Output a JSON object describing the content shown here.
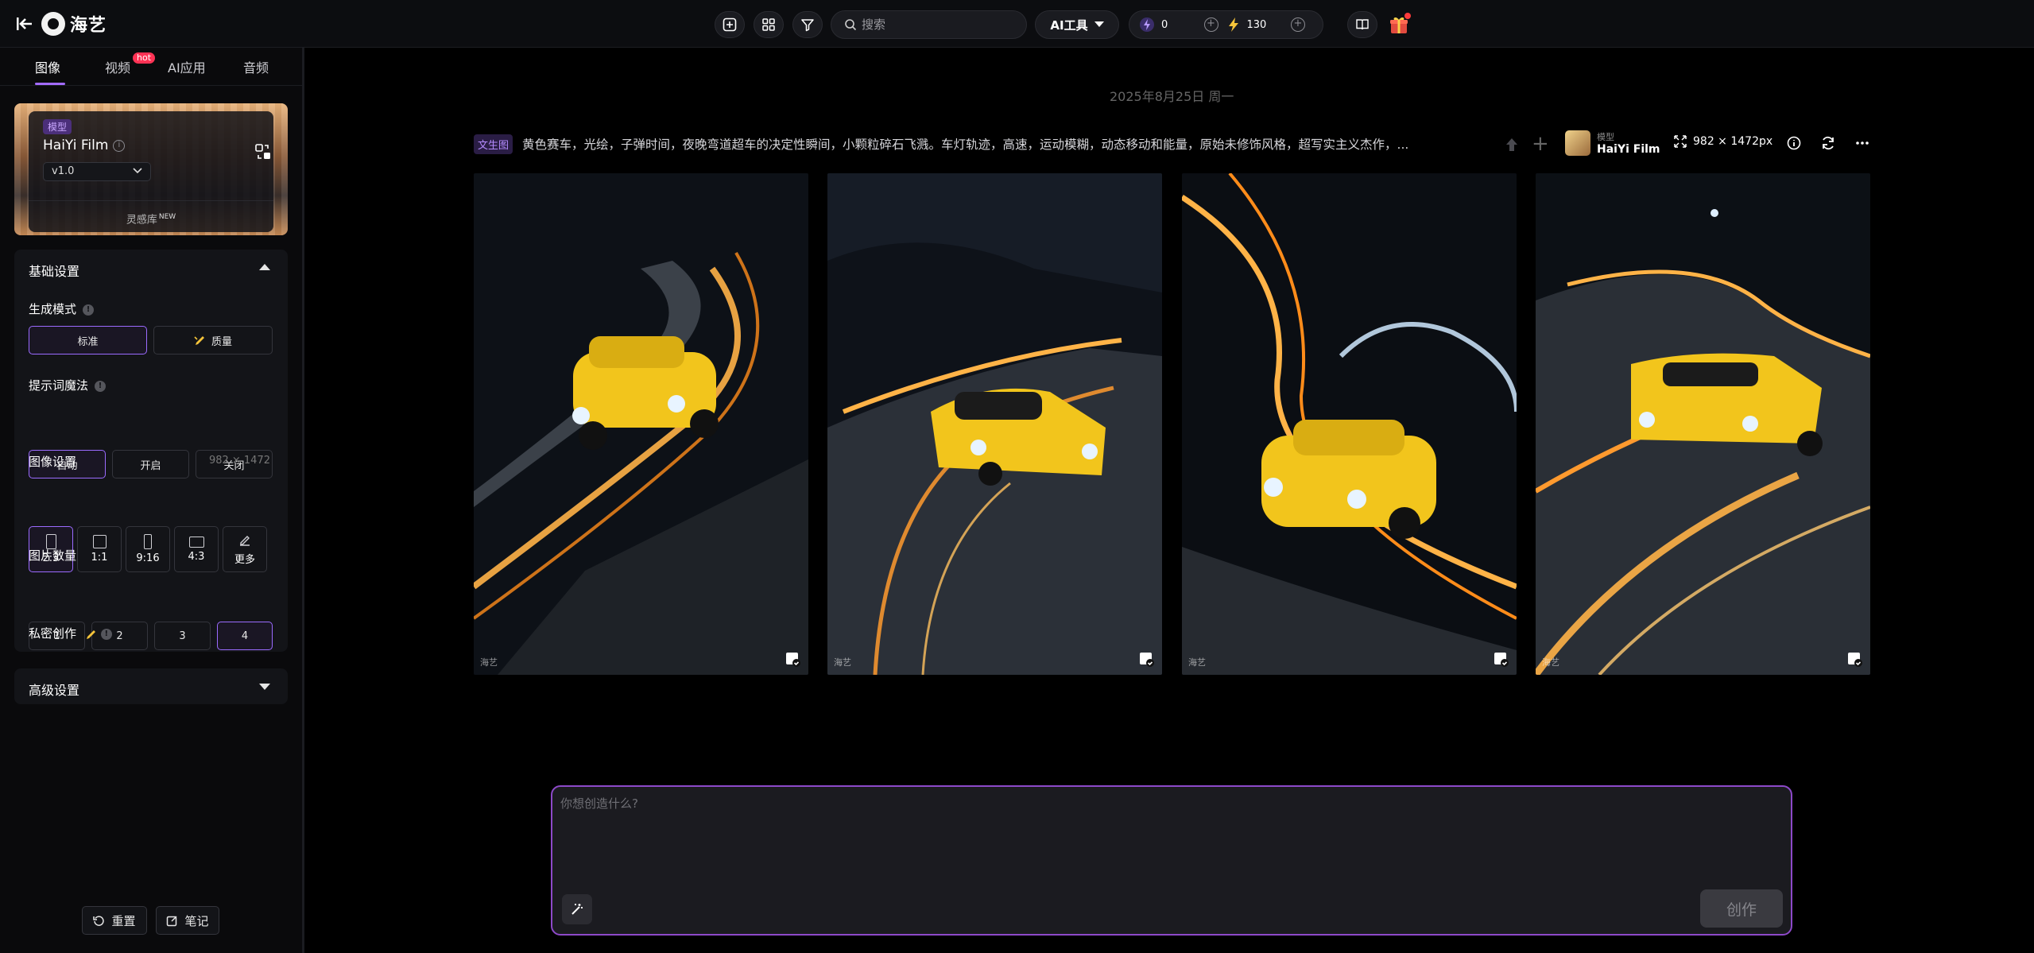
{
  "header": {
    "logo_text": "海艺",
    "search_placeholder": "搜索",
    "ai_tools_label": "AI工具",
    "credits": {
      "energy": "0",
      "lightning": "130"
    }
  },
  "sidebar": {
    "tabs": [
      {
        "label": "图像",
        "active": true
      },
      {
        "label": "视频",
        "badge": "hot"
      },
      {
        "label": "AI应用"
      },
      {
        "label": "音频"
      }
    ],
    "model": {
      "tag": "模型",
      "name": "HaiYi Film",
      "version": "v1.0",
      "inspiration_label": "灵感库",
      "inspiration_badge": "NEW"
    },
    "basic_settings": {
      "title": "基础设置",
      "gen_mode_label": "生成模式",
      "gen_modes": [
        "标准",
        "质量"
      ],
      "gen_mode_selected": "标准",
      "prompt_magic_label": "提示词魔法",
      "prompt_magic_options": [
        "自动",
        "开启",
        "关闭"
      ],
      "prompt_magic_selected": "自动",
      "image_settings_label": "图像设置",
      "image_size": "982 × 1472",
      "ratios": [
        "2:3",
        "1:1",
        "9:16",
        "4:3",
        "更多"
      ],
      "ratio_selected": "2:3",
      "count_label": "图片数量",
      "counts": [
        "1",
        "2",
        "3",
        "4"
      ],
      "count_selected": "4",
      "private_label": "私密创作",
      "private_enabled": false
    },
    "advanced_settings": {
      "title": "高级设置"
    },
    "reset_label": "重置",
    "notes_label": "笔记"
  },
  "main": {
    "date": "2025年8月25日 周一",
    "task_tag": "文生图",
    "prompt": "黄色赛车，光绘，子弹时间，夜晚弯道超车的决定性瞬间，小颗粒碎石飞溅。车灯轨迹，高速，运动模糊，动态移动和能量，原始未修饰风格，超写实主义杰作，...",
    "model_label": "模型",
    "model_name": "HaiYi Film",
    "resolution": "982 × 1472px",
    "watermark": "海艺",
    "images": [
      {
        "name": "image-1"
      },
      {
        "name": "image-2"
      },
      {
        "name": "image-3"
      },
      {
        "name": "image-4"
      }
    ]
  },
  "composer": {
    "placeholder": "你想创造什么?",
    "create_label": "创作"
  },
  "colors": {
    "accent": "#9b6bff",
    "composer_border": "#8d49c9",
    "hot_badge": "#ff3355"
  }
}
